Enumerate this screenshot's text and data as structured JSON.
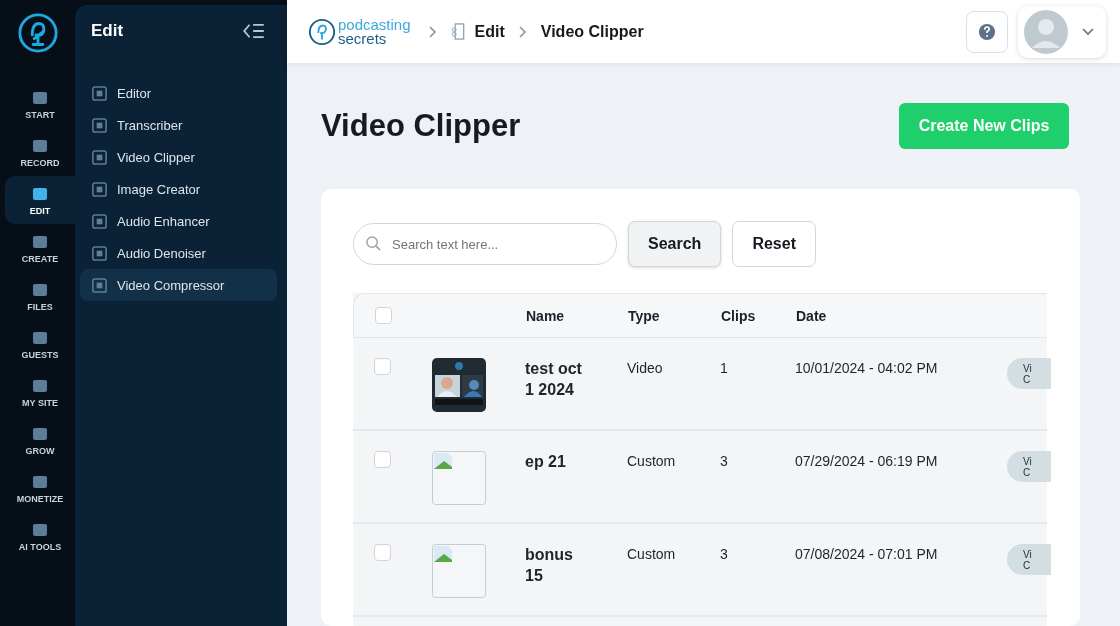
{
  "rail": {
    "items": [
      {
        "label": "START",
        "selected": false
      },
      {
        "label": "RECORD",
        "selected": false
      },
      {
        "label": "EDIT",
        "selected": true
      },
      {
        "label": "CREATE",
        "selected": false
      },
      {
        "label": "FILES",
        "selected": false
      },
      {
        "label": "GUESTS",
        "selected": false
      },
      {
        "label": "MY SITE",
        "selected": false
      },
      {
        "label": "GROW",
        "selected": false
      },
      {
        "label": "MONETIZE",
        "selected": false
      },
      {
        "label": "AI TOOLS",
        "selected": false
      }
    ]
  },
  "panel": {
    "title": "Edit",
    "items": [
      {
        "label": "Editor",
        "selected": false
      },
      {
        "label": "Transcriber",
        "selected": false
      },
      {
        "label": "Video Clipper",
        "selected": false
      },
      {
        "label": "Image Creator",
        "selected": false
      },
      {
        "label": "Audio Enhancer",
        "selected": false
      },
      {
        "label": "Audio Denoiser",
        "selected": false
      },
      {
        "label": "Video Compressor",
        "selected": true
      }
    ]
  },
  "header": {
    "logo": [
      "podcasting",
      "secrets"
    ],
    "breadcrumb": [
      "Edit",
      "Video Clipper"
    ]
  },
  "page": {
    "title": "Video Clipper",
    "create_button": "Create New Clips"
  },
  "search": {
    "placeholder": "Search text here...",
    "search_button": "Search",
    "reset_button": "Reset"
  },
  "table": {
    "header_checked": false,
    "columns": [
      "Name",
      "Type",
      "Clips",
      "Date"
    ],
    "rows": [
      {
        "checked": false,
        "kind": "picture",
        "name": "test oct 1 2024",
        "type": "Video",
        "clips": "1",
        "date": "10/01/2024 - 04:02 PM",
        "action": "Vi C"
      },
      {
        "checked": false,
        "kind": "broken",
        "name": "ep 21",
        "type": "Custom",
        "clips": "3",
        "date": "07/29/2024 - 06:19 PM",
        "action": "Vi C"
      },
      {
        "checked": false,
        "kind": "broken",
        "name": "bonus 15",
        "type": "Custom",
        "clips": "3",
        "date": "07/08/2024 - 07:01 PM",
        "action": "Vi C"
      }
    ]
  }
}
